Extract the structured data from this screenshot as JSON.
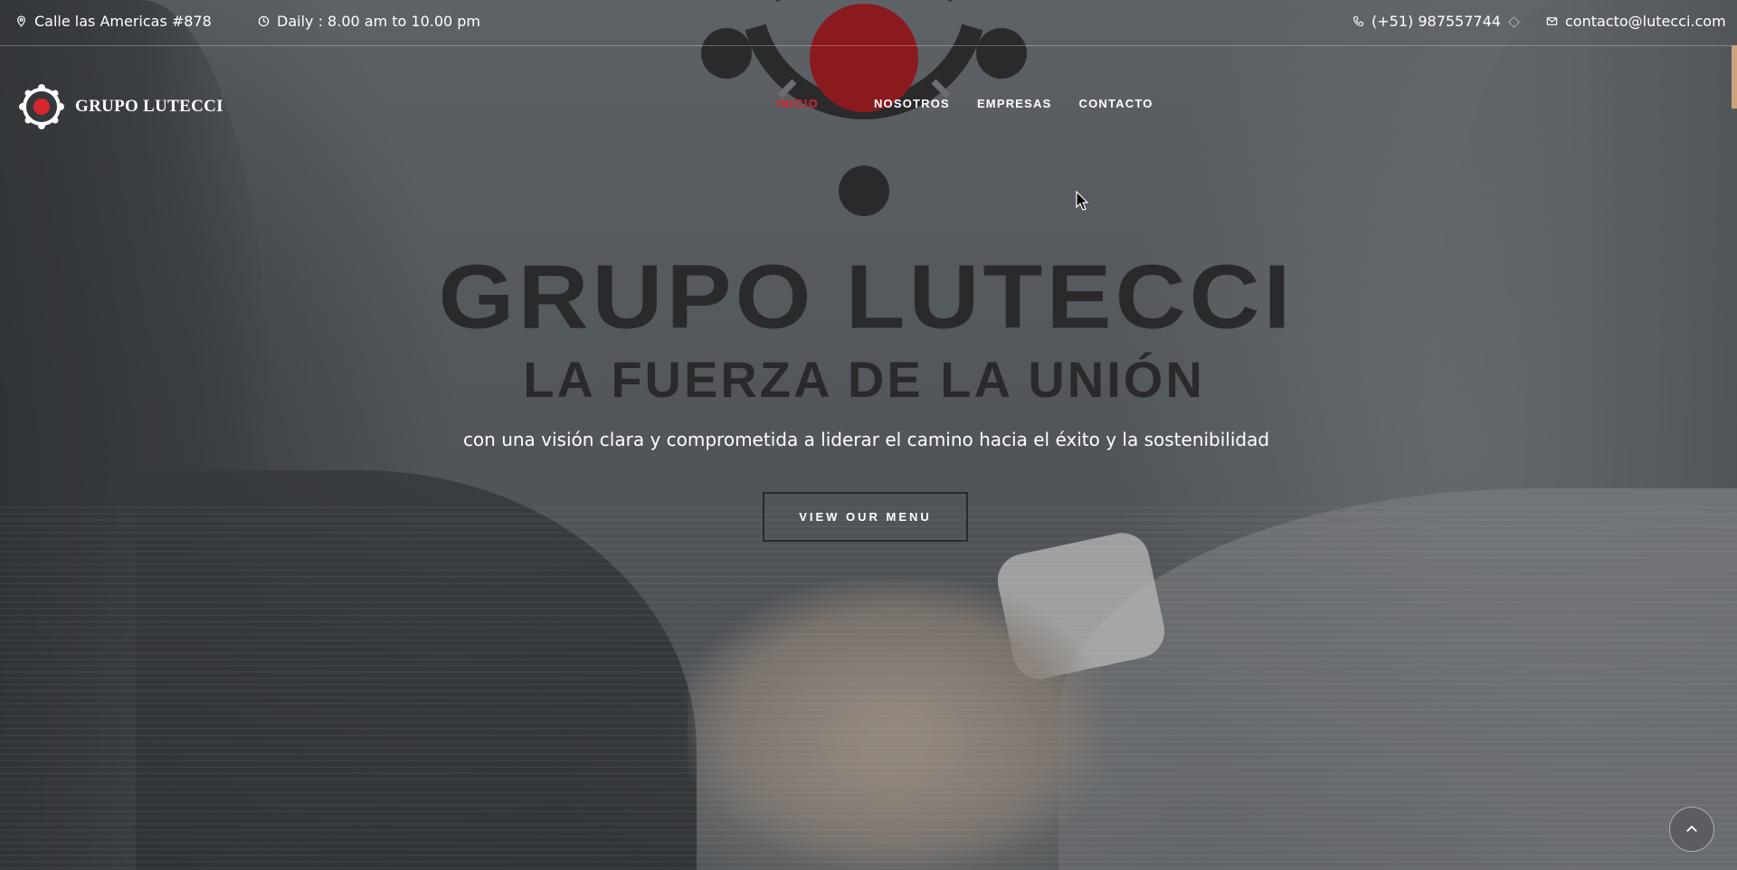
{
  "topbar": {
    "address": "Calle las Americas #878",
    "hours": "Daily : 8.00 am to 10.00 pm",
    "phone": "(+51) 987557744",
    "email": "contacto@lutecci.com",
    "icons": [
      "map-pin-icon",
      "clock-icon",
      "phone-icon",
      "mail-icon"
    ]
  },
  "logo": {
    "text": "GRUPO LUTECCI"
  },
  "nav": {
    "items": [
      {
        "label": "INICIO",
        "active": true
      },
      {
        "label": "NOSOTROS",
        "active": false
      },
      {
        "label": "EMPRESAS",
        "active": false
      },
      {
        "label": "CONTACTO",
        "active": false
      }
    ]
  },
  "hero": {
    "title": "GRUPO LUTECCI",
    "subtitle": "LA FUERZA DE LA UNIÓN",
    "tagline": "con una visión clara y comprometida a liderar el camino hacia el éxito y la sostenibilidad",
    "cta_label": "VIEW OUR MENU"
  },
  "colors": {
    "accent_red": "#d7262d",
    "emblem_red": "#8a1a1e",
    "dark_text": "#2a2a2c",
    "white": "#ffffff"
  }
}
